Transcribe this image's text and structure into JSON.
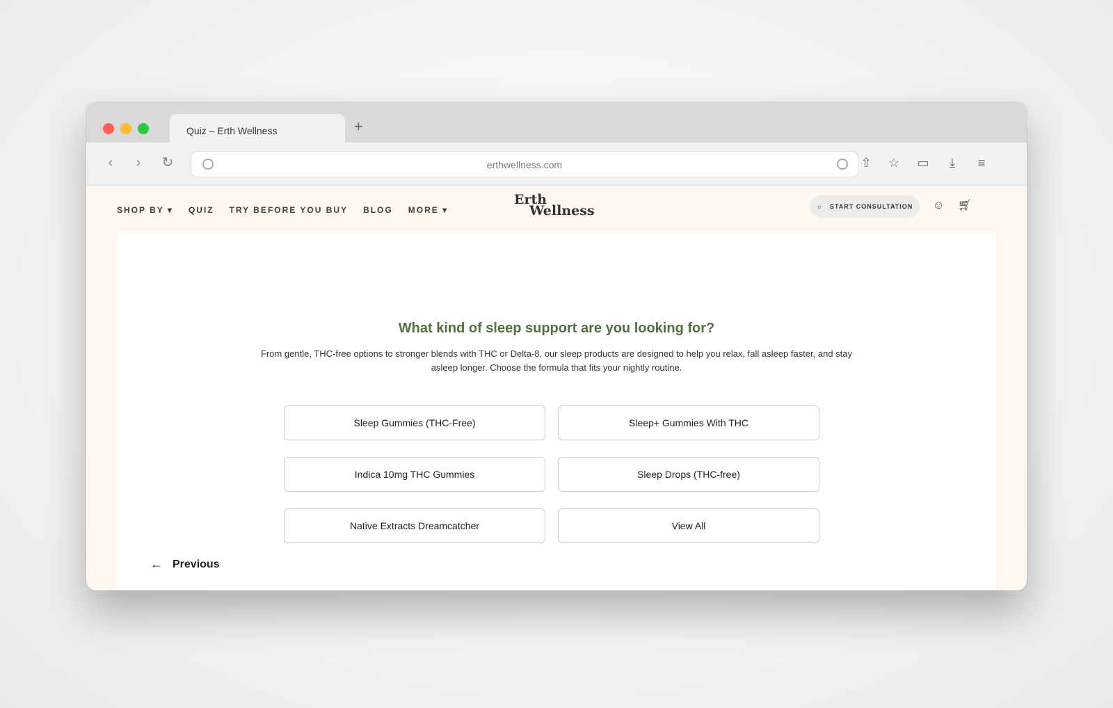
{
  "browser": {
    "tab_title": "Quiz – Erth Wellness",
    "new_tab_label": "+",
    "url": "erthwellness.com"
  },
  "site": {
    "nav": [
      "SHOP BY",
      "QUIZ",
      "TRY BEFORE YOU BUY",
      "BLOG",
      "MORE"
    ],
    "logo_line1": "Erth",
    "logo_line2": "Wellness",
    "consult_label": "START CONSULTATION"
  },
  "quiz": {
    "question": "What kind of sleep support are you looking for?",
    "description": "From gentle, THC-free options to stronger blends with THC or Delta-8, our sleep products are designed to help you relax, fall asleep faster, and stay asleep longer. Choose the formula that fits your nightly routine.",
    "options": [
      "Sleep Gummies (THC-Free)",
      "Sleep+ Gummies With THC",
      "Indica 10mg THC Gummies",
      "Sleep Drops (THC-free)",
      "Native Extracts Dreamcatcher",
      "View All"
    ],
    "previous_label": "Previous"
  }
}
